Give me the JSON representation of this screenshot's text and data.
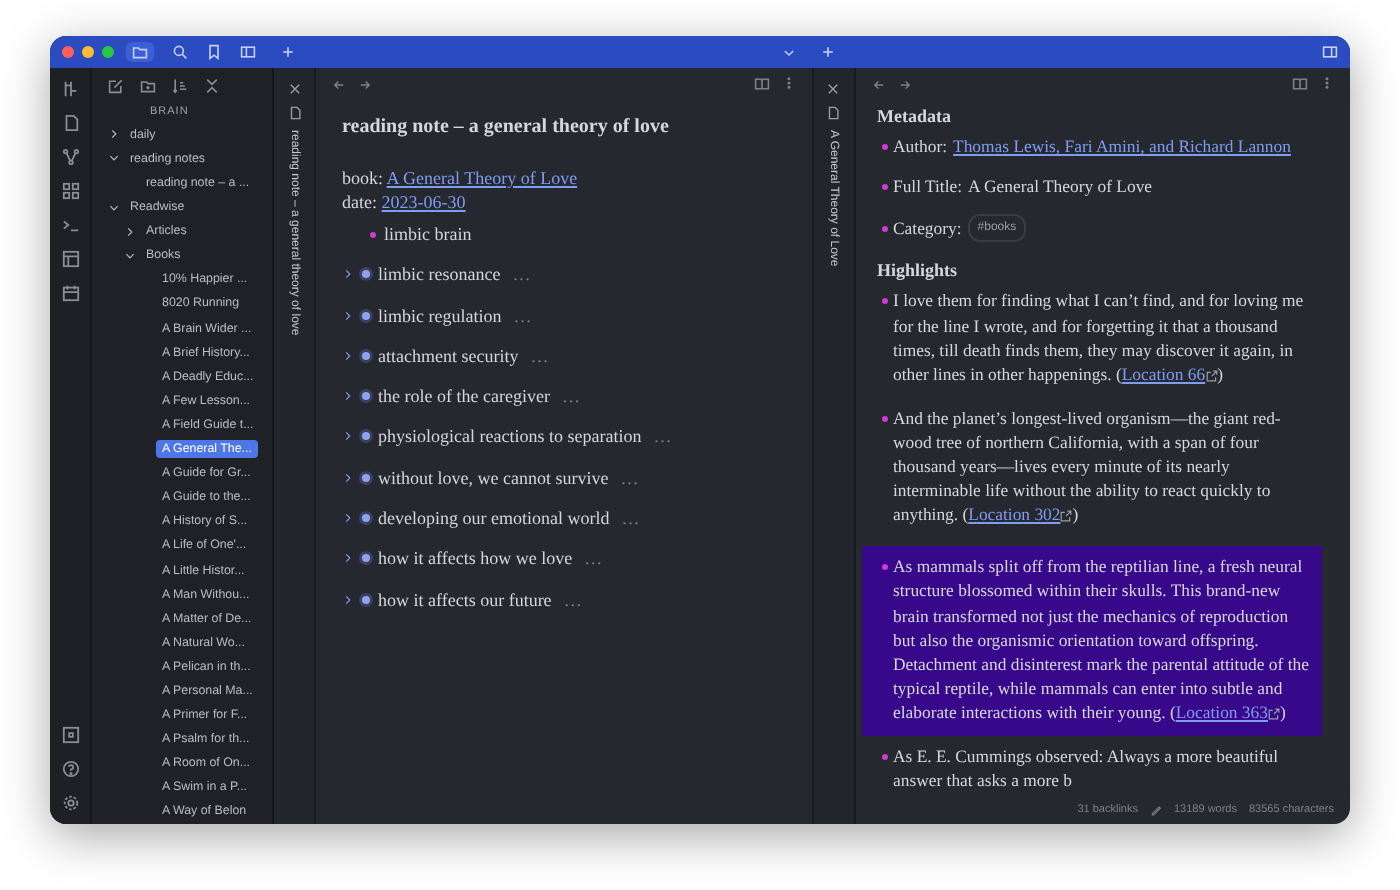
{
  "sidebar": {
    "vault_name": "BRAIN",
    "tree": [
      {
        "label": "daily",
        "expanded": false
      },
      {
        "label": "reading notes",
        "expanded": true,
        "children": [
          {
            "label": "reading note – a ...",
            "selected": false
          }
        ]
      },
      {
        "label": "Readwise",
        "expanded": true,
        "children": [
          {
            "label": "Articles",
            "expanded": false
          },
          {
            "label": "Books",
            "expanded": true,
            "children": [
              {
                "label": "10% Happier ...",
                "selected": false
              },
              {
                "label": "8020 Running",
                "selected": false
              },
              {
                "label": "A Brain Wider ...",
                "selected": false
              },
              {
                "label": "A Brief History...",
                "selected": false
              },
              {
                "label": "A Deadly Educ...",
                "selected": false
              },
              {
                "label": "A Few Lesson...",
                "selected": false
              },
              {
                "label": "A Field Guide t...",
                "selected": false
              },
              {
                "label": "A General The...",
                "selected": true
              },
              {
                "label": "A Guide for Gr...",
                "selected": false
              },
              {
                "label": "A Guide to the...",
                "selected": false
              },
              {
                "label": "A History of S...",
                "selected": false
              },
              {
                "label": "A Life of One'...",
                "selected": false
              },
              {
                "label": "A Little Histor...",
                "selected": false
              },
              {
                "label": "A Man Withou...",
                "selected": false
              },
              {
                "label": "A Matter of De...",
                "selected": false
              },
              {
                "label": "A Natural Wo...",
                "selected": false
              },
              {
                "label": "A Pelican in th...",
                "selected": false
              },
              {
                "label": "A Personal Ma...",
                "selected": false
              },
              {
                "label": "A Primer for F...",
                "selected": false
              },
              {
                "label": "A Psalm for th...",
                "selected": false
              },
              {
                "label": "A Room of On...",
                "selected": false
              },
              {
                "label": "A Swim in a P...",
                "selected": false
              },
              {
                "label": "A Way of Belon",
                "selected": false
              }
            ]
          }
        ]
      }
    ]
  },
  "left_pane": {
    "tab_title": "reading note – a general theory of love",
    "title": "reading note – a general theory of love",
    "properties": [
      {
        "key": "book:",
        "value": "A General Theory of Love"
      },
      {
        "key": "date:",
        "value": "2023-06-30"
      }
    ],
    "outline": [
      {
        "text": "limbic brain",
        "folded": false
      },
      {
        "text": "limbic resonance",
        "folded": true,
        "suffix": "…"
      },
      {
        "text": "limbic regulation",
        "folded": true,
        "suffix": "…"
      },
      {
        "text": " attachment security",
        "folded": true,
        "suffix": "…"
      },
      {
        "text": "the role of the caregiver",
        "folded": true,
        "suffix": "…"
      },
      {
        "text": "physiological reactions to separation",
        "folded": true,
        "suffix": "…"
      },
      {
        "text": "without love, we cannot survive",
        "folded": true,
        "suffix": "…"
      },
      {
        "text": "developing our emotional world",
        "folded": true,
        "suffix": "…"
      },
      {
        "text": "how it affects how we love",
        "folded": true,
        "suffix": "…"
      },
      {
        "text": "how it affects our future",
        "folded": true,
        "suffix": "…"
      }
    ]
  },
  "right_pane": {
    "tab_title": "A General Theory of Love",
    "metadata_heading": "Metadata",
    "metadata": [
      {
        "kind": "link",
        "label": "Author:",
        "value": "Thomas Lewis, Fari Amini, and Richard Lannon"
      },
      {
        "kind": "text",
        "label": "Full Title:",
        "value": "A General Theory of Love"
      },
      {
        "kind": "tag",
        "label": "Category:",
        "value": "#books"
      }
    ],
    "highlights_heading": "Highlights",
    "highlights": [
      {
        "text": "I love them for finding what I can’t find, and for loving me for the line I wrote, and for forgetting it  that a thousand times, till death finds them, they may discover it again, in other lines in other happenings. (",
        "link": "Location 66",
        "after": ")",
        "selected": false
      },
      {
        "text": "And the planet’s longest-lived organism—the giant red-wood tree of northern California, with a span of four thousand years—lives every minute of its nearly interminable life without the ability to react quickly to anything. (",
        "link": "Location 302",
        "after": ")",
        "selected": false
      },
      {
        "text": "As mammals split off from the reptilian line, a fresh neural structure blossomed within their skulls. This brand-new brain transformed not just the mechanics of reproduction but also the organismic orientation toward offspring. Detachment and disinterest mark the parental attitude of the typical reptile, while mammals can enter into subtle and elaborate interactions with their young. (",
        "link": "Location 363",
        "after": ")",
        "selected": true
      },
      {
        "text": "As E. E. Cummings observed: Always a more beautiful answer that asks a more b",
        "selected": false
      }
    ],
    "status_bar": {
      "backlinks": "31 backlinks",
      "words": "13189 words",
      "characters": "83565 characters"
    }
  }
}
